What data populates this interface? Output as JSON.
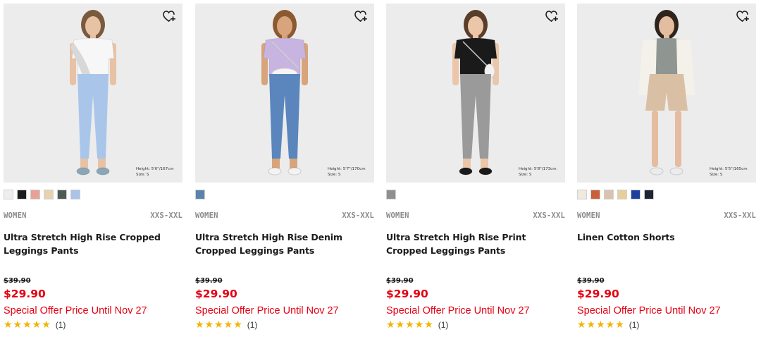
{
  "products": [
    {
      "gender": "WOMEN",
      "sizes": "XXS-XXL",
      "name": "Ultra Stretch High Rise Cropped Leggings Pants",
      "original_price": "$39.90",
      "sale_price": "$29.90",
      "offer": "Special Offer Price Until Nov 27",
      "rating": 5,
      "stars": "★★★★★",
      "review_count": "(1)",
      "model_height": "Height: 5'6\"/167cm",
      "model_size": "Size: S",
      "swatches": [
        "#eeeeee",
        "#1c1c1c",
        "#e8a099",
        "#e6d2b0",
        "#4d5a55",
        "#a9c4e8"
      ],
      "palette": {
        "bg": "#ececec",
        "top": "#f7f7f7",
        "bottom": "#a9c6ea",
        "shoe": "#8aa6b8",
        "accent": "#d8d8d8",
        "hair": "#7a5a3d",
        "skin": "#e8c2a4"
      }
    },
    {
      "gender": "WOMEN",
      "sizes": "XXS-XXL",
      "name": "Ultra Stretch High Rise Denim Cropped Leggings Pants",
      "original_price": "$39.90",
      "sale_price": "$29.90",
      "offer": "Special Offer Price Until Nov 27",
      "rating": 5,
      "stars": "★★★★★",
      "review_count": "(1)",
      "model_height": "Height: 5'7\"/170cm",
      "model_size": "Size: S",
      "swatches": [
        "#5b82ad"
      ],
      "palette": {
        "bg": "#ececec",
        "top": "#c7b4e0",
        "bottom": "#5a86bd",
        "shoe": "#f3f3f3",
        "accent": "#f4f4f4",
        "hair": "#8a5a30",
        "skin": "#d8a47c"
      }
    },
    {
      "gender": "WOMEN",
      "sizes": "XXS-XXL",
      "name": "Ultra Stretch High Rise Print Cropped Leggings Pants",
      "original_price": "$39.90",
      "sale_price": "$29.90",
      "offer": "Special Offer Price Until Nov 27",
      "rating": 5,
      "stars": "★★★★★",
      "review_count": "(1)",
      "model_height": "Height: 5'8\"/173cm",
      "model_size": "Size: S",
      "swatches": [
        "#8f8f8f"
      ],
      "palette": {
        "bg": "#ececec",
        "top": "#1a1a1a",
        "bottom": "#9a9a9a",
        "shoe": "#1a1a1a",
        "accent": "#f2f2f2",
        "hair": "#5a3e2a",
        "skin": "#ecc6a8"
      }
    },
    {
      "gender": "WOMEN",
      "sizes": "XXS-XXL",
      "name": "Linen Cotton Shorts",
      "original_price": "$39.90",
      "sale_price": "$29.90",
      "offer": "Special Offer Price Until Nov 27",
      "rating": 5,
      "stars": "★★★★★",
      "review_count": "(1)",
      "model_height": "Height: 5'5\"/165cm",
      "model_size": "Size: S",
      "swatches": [
        "#efe9de",
        "#c9603b",
        "#d9c2b0",
        "#e7cf9d",
        "#1f3f9e",
        "#1d2433"
      ],
      "palette": {
        "bg": "#ececec",
        "top": "#8f9692",
        "bottom": "#d9c0a4",
        "shoe": "#ececec",
        "accent": "#f3f1ea",
        "hair": "#2e241c",
        "skin": "#e4bca0"
      }
    }
  ],
  "icons": {
    "favorite": "heart-plus-icon",
    "star": "star-icon"
  },
  "colors": {
    "sale_red": "#e60012",
    "star_gold": "#f2b400",
    "meta_gray": "#8a8a8a"
  }
}
